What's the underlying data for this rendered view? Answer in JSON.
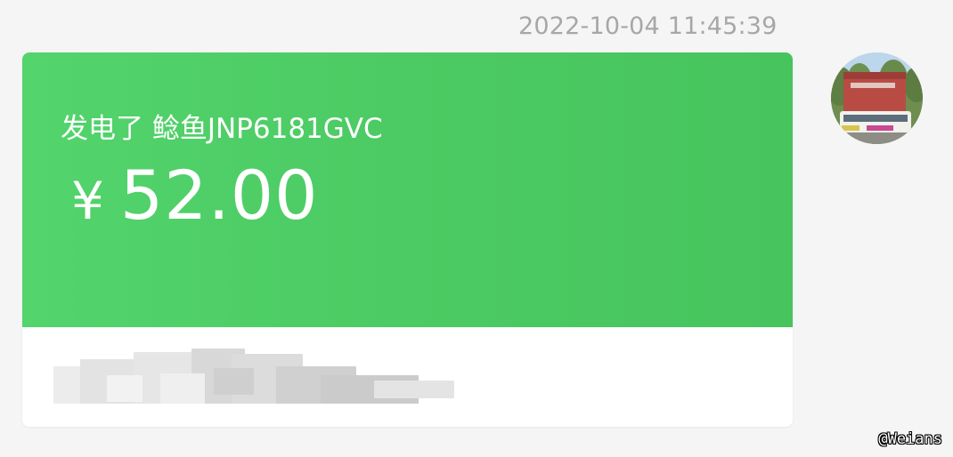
{
  "message": {
    "timestamp": "2022-10-04 11:45:39",
    "transfer": {
      "note": "发电了 鲶鱼JNP6181GVC",
      "currency": "¥",
      "amount": "52.00"
    }
  },
  "sender": {
    "avatar": "avatar-bus-depot-photo"
  },
  "watermark": "@Weians",
  "colors": {
    "card_green": "#4fcf68",
    "card_bottom": "#ffffff",
    "background": "#f5f5f5",
    "timestamp_gray": "#a7a7a7"
  }
}
